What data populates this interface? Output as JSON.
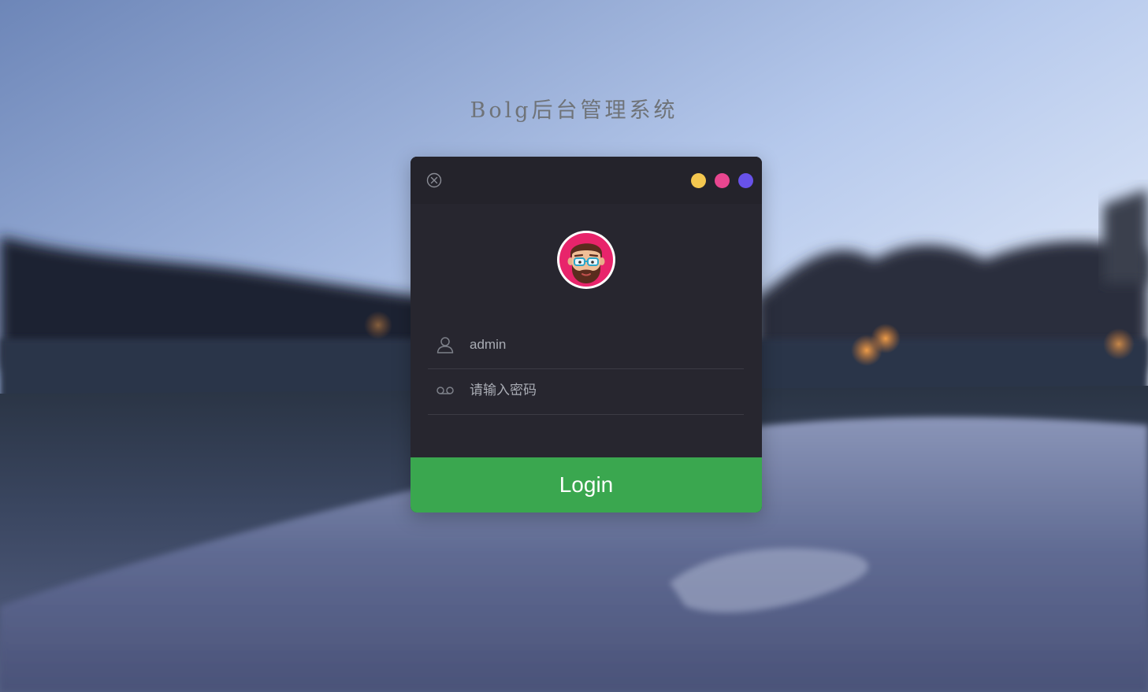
{
  "app": {
    "title": "Bolg后台管理系统"
  },
  "login": {
    "username_value": "admin",
    "password_placeholder": "请输入密码",
    "login_label": "Login",
    "window_dots": [
      "yellow",
      "pink",
      "purple"
    ]
  },
  "icons": {
    "close": "close-circle-icon",
    "user": "user-icon",
    "password": "password-icon",
    "avatar": "avatar-icon"
  },
  "colors": {
    "panel": "#27262f",
    "titlebar": "#24232b",
    "button": "#3aa74f",
    "dot_yellow": "#f4c74f",
    "dot_pink": "#e8468f",
    "dot_purple": "#6852e9",
    "avatar_ring": "#e8246b"
  }
}
